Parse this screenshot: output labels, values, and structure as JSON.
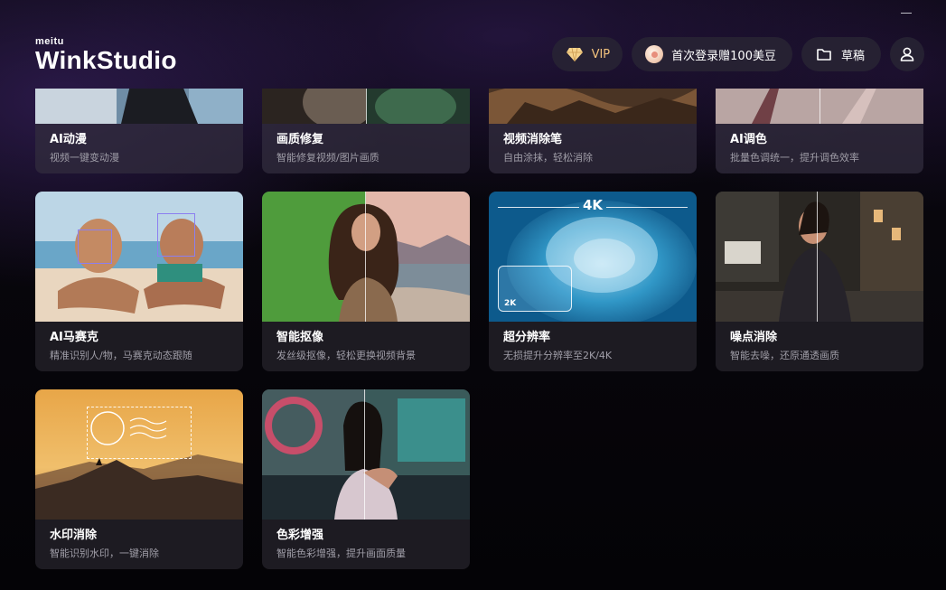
{
  "app": {
    "brand_small": "meitu",
    "brand_main": "WinkStudio"
  },
  "header": {
    "vip_label": "VIP",
    "promo_label": "首次登录赠100美豆",
    "drafts_label": "草稿"
  },
  "colors": {
    "accent_vip": "#f2c27d",
    "face_box": "#8c7ff0"
  },
  "tools": [
    {
      "title": "AI动漫",
      "desc": "视频一键变动漫"
    },
    {
      "title": "画质修复",
      "desc": "智能修复视频/图片画质"
    },
    {
      "title": "视频消除笔",
      "desc": "自由涂抹，轻松消除"
    },
    {
      "title": "AI调色",
      "desc": "批量色调统一，提升调色效率"
    },
    {
      "title": "AI马赛克",
      "desc": "精准识别人/物，马赛克动态跟随"
    },
    {
      "title": "智能抠像",
      "desc": "发丝级抠像，轻松更换视频背景"
    },
    {
      "title": "超分辨率",
      "desc": "无损提升分辨率至2K/4K",
      "overlay_4k": "4K",
      "overlay_2k": "2K"
    },
    {
      "title": "噪点消除",
      "desc": "智能去噪，还原通透画质"
    },
    {
      "title": "水印消除",
      "desc": "智能识别水印，一键消除"
    },
    {
      "title": "色彩增强",
      "desc": "智能色彩增强，提升画面质量"
    }
  ]
}
